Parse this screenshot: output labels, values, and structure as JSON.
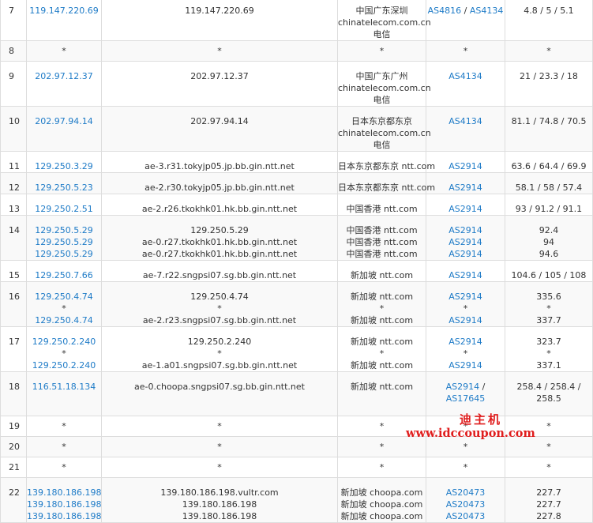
{
  "rows": [
    {
      "no": "7",
      "ips": [
        "119.147.220.69"
      ],
      "hosts": [
        "119.147.220.69"
      ],
      "locs": [
        "中国广东深圳 chinatelecom.com.cn 电信"
      ],
      "as": [
        [
          "AS4816",
          "AS4134"
        ]
      ],
      "times": [
        "4.8 / 5 / 5.1"
      ]
    },
    {
      "no": "8",
      "ips": [
        "*"
      ],
      "hosts": [
        "*"
      ],
      "locs": [
        "*"
      ],
      "as": [
        [
          "*"
        ]
      ],
      "times": [
        "*"
      ]
    },
    {
      "no": "9",
      "ips": [
        "202.97.12.37"
      ],
      "hosts": [
        "202.97.12.37"
      ],
      "locs": [
        "中国广东广州 chinatelecom.com.cn 电信"
      ],
      "as": [
        [
          "AS4134"
        ]
      ],
      "times": [
        "21 / 23.3 / 18"
      ]
    },
    {
      "no": "10",
      "ips": [
        "202.97.94.14"
      ],
      "hosts": [
        "202.97.94.14"
      ],
      "locs": [
        "日本东京都东京 chinatelecom.com.cn 电信"
      ],
      "as": [
        [
          "AS4134"
        ]
      ],
      "times": [
        "81.1 / 74.8 / 70.5"
      ]
    },
    {
      "no": "11",
      "ips": [
        "129.250.3.29"
      ],
      "hosts": [
        "ae-3.r31.tokyjp05.jp.bb.gin.ntt.net"
      ],
      "locs": [
        "日本东京都东京 ntt.com"
      ],
      "as": [
        [
          "AS2914"
        ]
      ],
      "times": [
        "63.6 / 64.4 / 69.9"
      ]
    },
    {
      "no": "12",
      "ips": [
        "129.250.5.23"
      ],
      "hosts": [
        "ae-2.r30.tokyjp05.jp.bb.gin.ntt.net"
      ],
      "locs": [
        "日本东京都东京 ntt.com"
      ],
      "as": [
        [
          "AS2914"
        ]
      ],
      "times": [
        "58.1 / 58 / 57.4"
      ]
    },
    {
      "no": "13",
      "ips": [
        "129.250.2.51"
      ],
      "hosts": [
        "ae-2.r26.tkokhk01.hk.bb.gin.ntt.net"
      ],
      "locs": [
        "中国香港 ntt.com"
      ],
      "as": [
        [
          "AS2914"
        ]
      ],
      "times": [
        "93 / 91.2 / 91.1"
      ]
    },
    {
      "no": "14",
      "ips": [
        "129.250.5.29",
        "129.250.5.29",
        "129.250.5.29"
      ],
      "hosts": [
        "129.250.5.29",
        "ae-0.r27.tkokhk01.hk.bb.gin.ntt.net",
        "ae-0.r27.tkokhk01.hk.bb.gin.ntt.net"
      ],
      "locs": [
        "中国香港 ntt.com",
        "中国香港 ntt.com",
        "中国香港 ntt.com"
      ],
      "as": [
        [
          "AS2914"
        ],
        [
          "AS2914"
        ],
        [
          "AS2914"
        ]
      ],
      "times": [
        "92.4",
        "94",
        "94.6"
      ]
    },
    {
      "no": "15",
      "ips": [
        "129.250.7.66"
      ],
      "hosts": [
        "ae-7.r22.sngpsi07.sg.bb.gin.ntt.net"
      ],
      "locs": [
        "新加坡 ntt.com"
      ],
      "as": [
        [
          "AS2914"
        ]
      ],
      "times": [
        "104.6 / 105 / 108"
      ]
    },
    {
      "no": "16",
      "ips": [
        "129.250.4.74",
        "*",
        "129.250.4.74"
      ],
      "hosts": [
        "129.250.4.74",
        "*",
        "ae-2.r23.sngpsi07.sg.bb.gin.ntt.net"
      ],
      "locs": [
        "新加坡 ntt.com",
        "*",
        "新加坡 ntt.com"
      ],
      "as": [
        [
          "AS2914"
        ],
        [
          "*"
        ],
        [
          "AS2914"
        ]
      ],
      "times": [
        "335.6",
        "*",
        "337.7"
      ]
    },
    {
      "no": "17",
      "ips": [
        "129.250.2.240",
        "*",
        "129.250.2.240"
      ],
      "hosts": [
        "129.250.2.240",
        "*",
        "ae-1.a01.sngpsi07.sg.bb.gin.ntt.net"
      ],
      "locs": [
        "新加坡 ntt.com",
        "*",
        "新加坡 ntt.com"
      ],
      "as": [
        [
          "AS2914"
        ],
        [
          "*"
        ],
        [
          "AS2914"
        ]
      ],
      "times": [
        "323.7",
        "*",
        "337.1"
      ]
    },
    {
      "no": "18",
      "ips": [
        "116.51.18.134"
      ],
      "hosts": [
        "ae-0.choopa.sngpsi07.sg.bb.gin.ntt.net"
      ],
      "locs": [
        "新加坡 ntt.com"
      ],
      "as": [
        [
          "AS2914",
          "AS17645"
        ]
      ],
      "times": [
        "258.4 / 258.4 / 258.5"
      ]
    },
    {
      "no": "19",
      "ips": [
        "*"
      ],
      "hosts": [
        "*"
      ],
      "locs": [
        "*"
      ],
      "as": [
        [
          "*"
        ]
      ],
      "times": [
        "*"
      ]
    },
    {
      "no": "20",
      "ips": [
        "*"
      ],
      "hosts": [
        "*"
      ],
      "locs": [
        "*"
      ],
      "as": [
        [
          "*"
        ]
      ],
      "times": [
        "*"
      ]
    },
    {
      "no": "21",
      "ips": [
        "*"
      ],
      "hosts": [
        "*"
      ],
      "locs": [
        "*"
      ],
      "as": [
        [
          "*"
        ]
      ],
      "times": [
        "*"
      ]
    },
    {
      "no": "22",
      "ips": [
        "139.180.186.198",
        "139.180.186.198",
        "139.180.186.198"
      ],
      "hosts": [
        "139.180.186.198.vultr.com",
        "139.180.186.198",
        "139.180.186.198"
      ],
      "locs": [
        "新加坡 choopa.com",
        "新加坡 choopa.com",
        "新加坡 choopa.com"
      ],
      "as": [
        [
          "AS20473"
        ],
        [
          "AS20473"
        ],
        [
          "AS20473"
        ]
      ],
      "times": [
        "227.7",
        "227.7",
        "227.8"
      ]
    }
  ],
  "watermark": {
    "line1": "迪主机",
    "line2": "www.idccoupon.com"
  },
  "colors": {
    "link": "#1e7bc7",
    "text": "#333333",
    "border": "#dddddd",
    "alt_row": "#f9f9f9",
    "watermark": "#e01d1d"
  }
}
